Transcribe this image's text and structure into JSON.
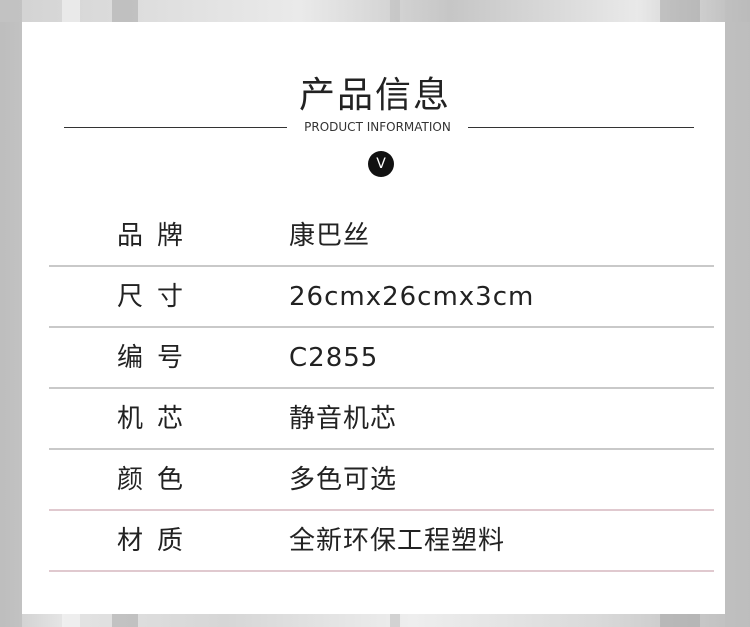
{
  "header": {
    "title": "产品信息",
    "subtitle": "PRODUCT INFORMATION",
    "badge": "V"
  },
  "specs": [
    {
      "label": "品牌",
      "value": "康巴丝"
    },
    {
      "label": "尺寸",
      "value": "26cmx26cmx3cm"
    },
    {
      "label": "编号",
      "value": "C2855"
    },
    {
      "label": "机芯",
      "value": "静音机芯"
    },
    {
      "label": "颜色",
      "value": "多色可选"
    },
    {
      "label": "材质",
      "value": "全新环保工程塑料"
    }
  ]
}
